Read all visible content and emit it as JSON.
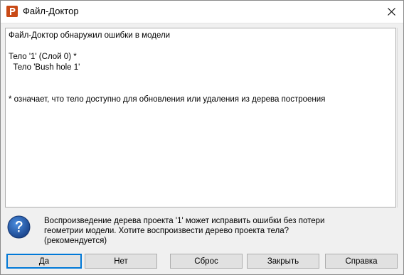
{
  "window": {
    "title": "Файл-Доктор"
  },
  "report": {
    "lines": [
      "Файл-Доктор обнаружил ошибки в модели",
      "",
      "Тело '1' (Слой 0) *",
      "  Тело 'Bush hole 1'",
      "",
      "",
      "* означает, что тело доступно для обновления или удаления из дерева построения"
    ]
  },
  "message": {
    "icon": "question-icon",
    "line1": "Воспроизведение дерева проекта '1' может исправить ошибки без потери",
    "line2": "геометрии модели. Хотите воспроизвести дерево проекта тела?",
    "line3": "(рекомендуется)"
  },
  "buttons": {
    "yes": "Да",
    "no": "Нет",
    "reset": "Сброс",
    "close": "Закрыть",
    "help": "Справка"
  },
  "colors": {
    "app_icon": "#c94a16",
    "focus_border": "#0078d7",
    "question_icon": "#1e5aa8"
  }
}
